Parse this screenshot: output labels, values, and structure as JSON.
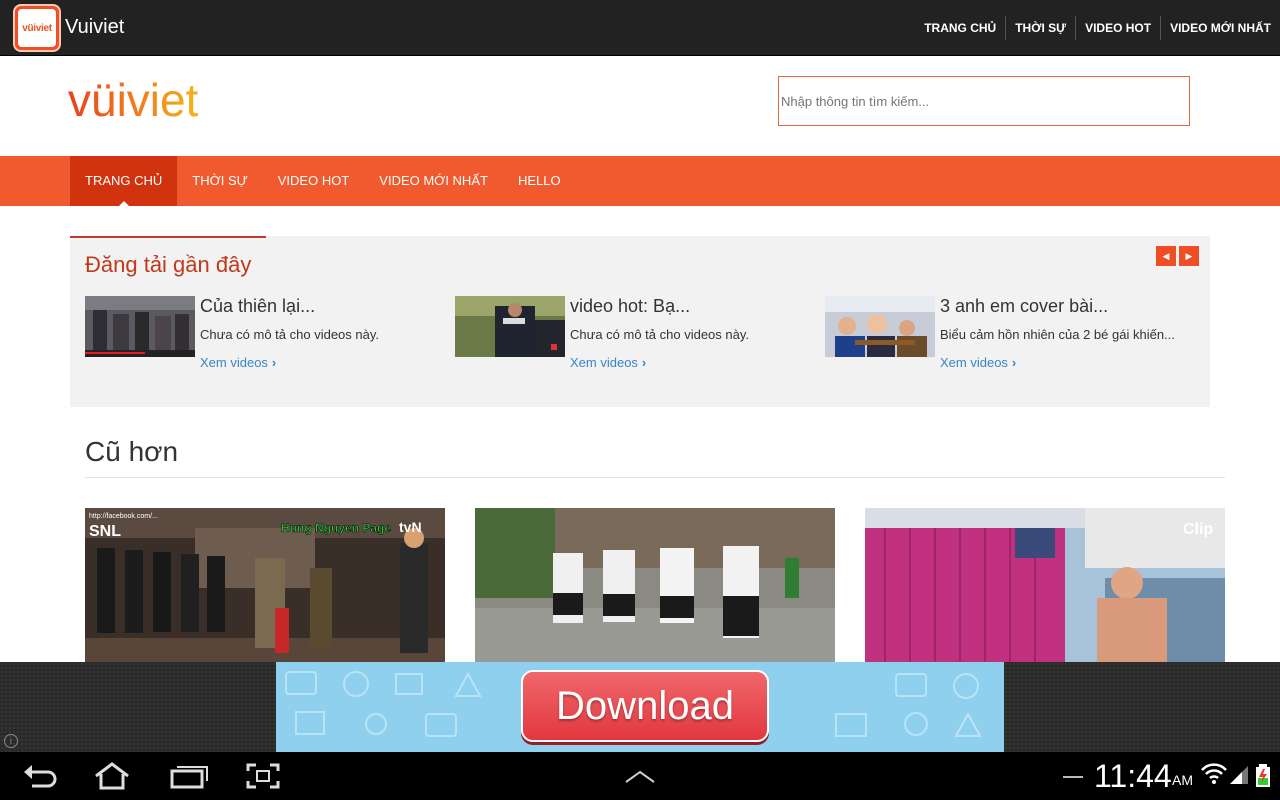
{
  "app": {
    "title": "Vuiviet",
    "icon_text": "vüiviet"
  },
  "actionbar": {
    "menu": [
      "TRANG CHỦ",
      "THỜI SỰ",
      "VIDEO HOT",
      "VIDEO MỚI NHẤT"
    ]
  },
  "header": {
    "logo_text": "vüiviet",
    "search_placeholder": "Nhập thông tin tìm kiếm..."
  },
  "nav": {
    "items": [
      {
        "label": "TRANG CHỦ"
      },
      {
        "label": "THỜI SỰ"
      },
      {
        "label": "VIDEO HOT"
      },
      {
        "label": "VIDEO MỚI NHẤT"
      },
      {
        "label": "HELLO"
      }
    ],
    "active_index": 0
  },
  "recent": {
    "title": "Đăng tải gần đây",
    "items": [
      {
        "title": "Của thiên lại...",
        "desc": "Chưa có mô tả cho videos này.",
        "link": "Xem videos"
      },
      {
        "title": "video hot: Bạ...",
        "desc": "Chưa có mô tả cho videos này.",
        "link": "Xem videos"
      },
      {
        "title": "3 anh em cover bài...",
        "desc": "Biểu cảm hồn nhiên của 2 bé gái khiến...",
        "link": "Xem videos"
      }
    ]
  },
  "older": {
    "title": "Cũ hơn",
    "thumb1_texts": {
      "top": "http://facebook.com/...",
      "brand": "SNL",
      "watermark": "Hung Nguyen Page",
      "channel": "tvN"
    },
    "thumb3_text": "Clip"
  },
  "ad": {
    "button_label": "Download",
    "info_label": "i"
  },
  "status": {
    "time": "11:44",
    "ampm": "AM"
  },
  "colors": {
    "accent": "#f15a2f",
    "nav_active": "#d2330f",
    "link": "#3a85c6",
    "title_red": "#c0391b"
  }
}
